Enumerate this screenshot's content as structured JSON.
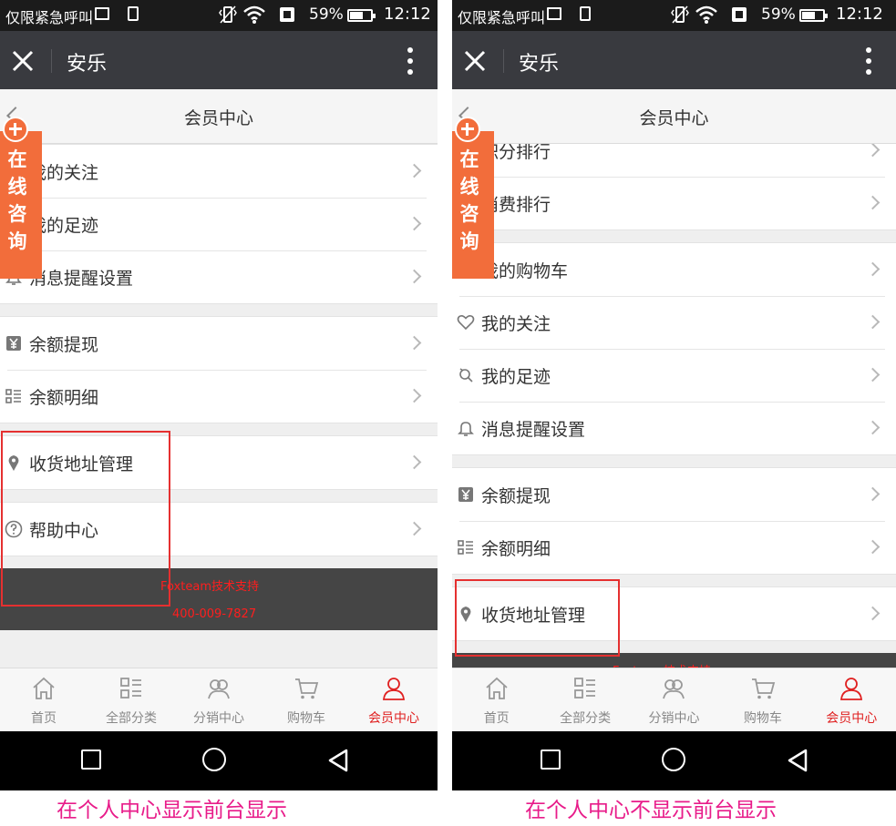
{
  "colors": {
    "accent": "#e02020",
    "consult_bg": "#f26d3b",
    "footer_text": "#ff1e1e",
    "caption": "#e81c8a",
    "titlebar": "#393a3f"
  },
  "left": {
    "statusbar": {
      "carrier": "仅限紧急呼叫",
      "battery_pct": "59%",
      "time": "12:12"
    },
    "titlebar": {
      "title": "安乐"
    },
    "header": {
      "title": "会员中心"
    },
    "consult_text": "在线咨询",
    "groups": [
      {
        "rows": [
          {
            "label": "我的关注",
            "icon": "heart-icon"
          },
          {
            "label": "我的足迹",
            "icon": "footprint-icon"
          },
          {
            "label": "消息提醒设置",
            "icon": "bell-icon"
          }
        ]
      },
      {
        "rows": [
          {
            "label": "余额提现",
            "icon": "yuan-icon"
          },
          {
            "label": "余额明细",
            "icon": "list-icon"
          }
        ]
      },
      {
        "rows": [
          {
            "label": "收货地址管理",
            "icon": "location-pin-icon"
          }
        ]
      },
      {
        "rows": [
          {
            "label": "帮助中心",
            "icon": "help-icon"
          }
        ]
      }
    ],
    "footer": {
      "line1": "Foxteam技术支持",
      "line2": "400-009-7827"
    },
    "tabs": [
      {
        "label": "首页",
        "icon": "home-icon"
      },
      {
        "label": "全部分类",
        "icon": "category-icon"
      },
      {
        "label": "分销中心",
        "icon": "distribution-icon"
      },
      {
        "label": "购物车",
        "icon": "cart-icon"
      },
      {
        "label": "会员中心",
        "icon": "user-icon",
        "active": true
      }
    ],
    "caption": "在个人中心显示前台显示"
  },
  "right": {
    "statusbar": {
      "carrier": "仅限紧急呼叫",
      "battery_pct": "59%",
      "time": "12:12"
    },
    "titlebar": {
      "title": "安乐"
    },
    "header": {
      "title": "会员中心"
    },
    "consult_text": "在线咨询",
    "groups": [
      {
        "rows": [
          {
            "label": "积分排行",
            "icon": "rank-icon"
          },
          {
            "label": "消费排行",
            "icon": "rank-icon"
          }
        ]
      },
      {
        "rows": [
          {
            "label": "我的购物车",
            "icon": "cart-icon"
          },
          {
            "label": "我的关注",
            "icon": "heart-icon"
          },
          {
            "label": "我的足迹",
            "icon": "footprint-icon"
          },
          {
            "label": "消息提醒设置",
            "icon": "bell-icon"
          }
        ]
      },
      {
        "rows": [
          {
            "label": "余额提现",
            "icon": "yuan-icon"
          },
          {
            "label": "余额明细",
            "icon": "list-icon"
          }
        ]
      },
      {
        "rows": [
          {
            "label": "收货地址管理",
            "icon": "location-pin-icon"
          }
        ]
      }
    ],
    "footer": {
      "line1": "Foxteam技术支持",
      "line2": ""
    },
    "tabs": [
      {
        "label": "首页",
        "icon": "home-icon"
      },
      {
        "label": "全部分类",
        "icon": "category-icon"
      },
      {
        "label": "分销中心",
        "icon": "distribution-icon"
      },
      {
        "label": "购物车",
        "icon": "cart-icon"
      },
      {
        "label": "会员中心",
        "icon": "user-icon",
        "active": true
      }
    ],
    "caption": "在个人中心不显示前台显示"
  }
}
